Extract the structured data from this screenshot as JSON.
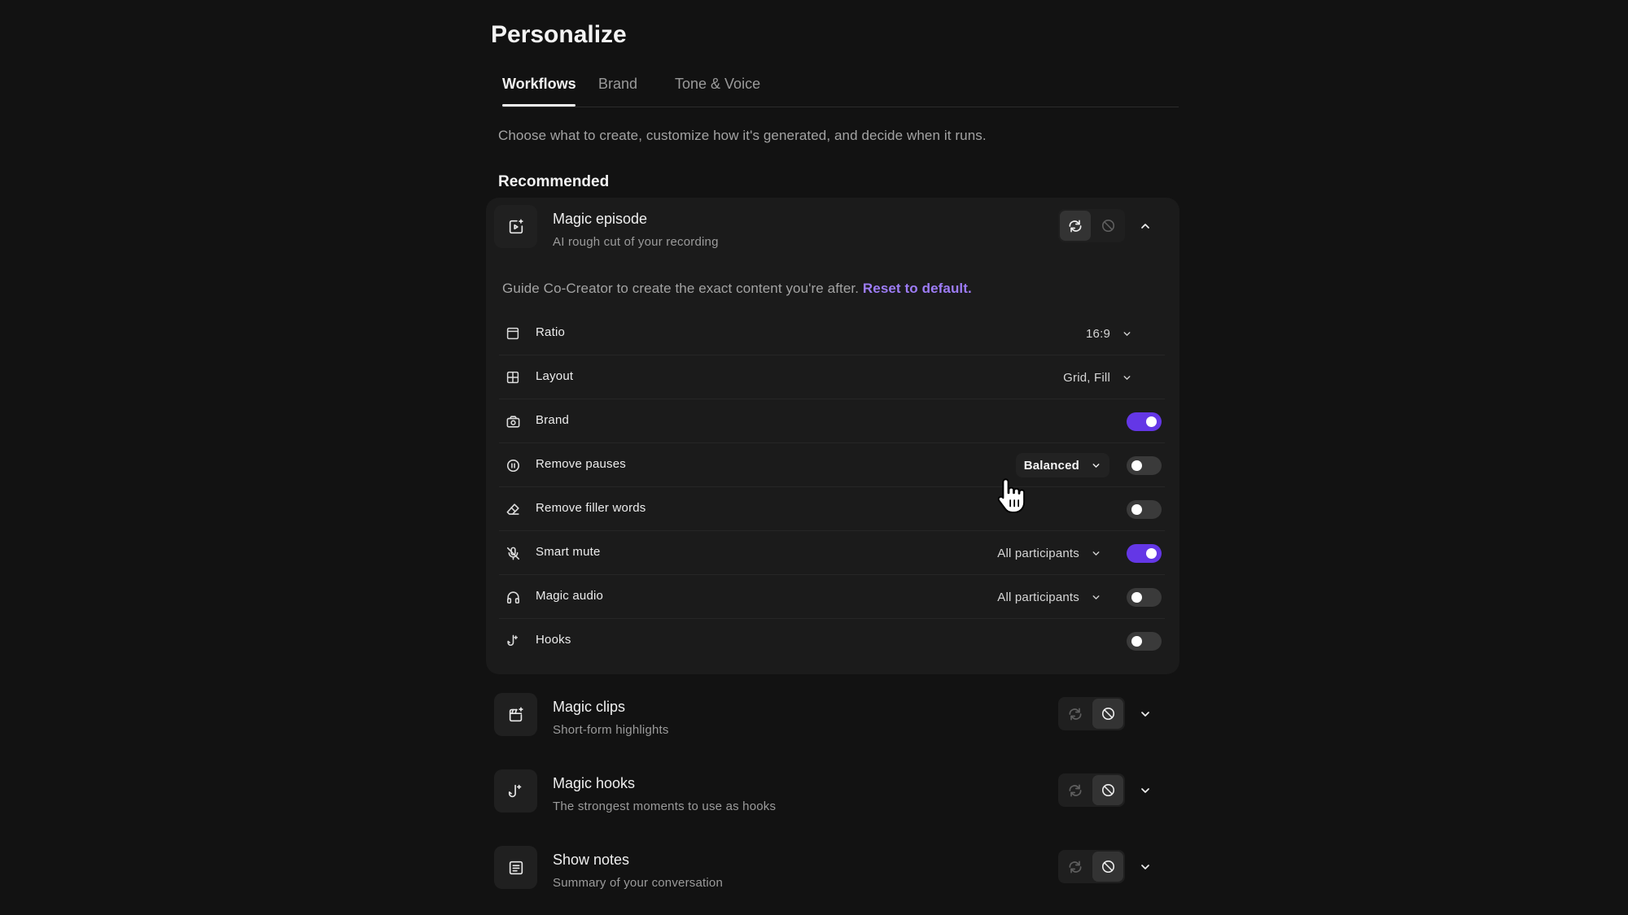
{
  "page": {
    "title": "Personalize"
  },
  "tabs": [
    {
      "label": "Workflows",
      "active": true
    },
    {
      "label": "Brand",
      "active": false
    },
    {
      "label": "Tone & Voice",
      "active": false
    }
  ],
  "description": "Choose what to create, customize how it's generated, and decide when it runs.",
  "section_title": "Recommended",
  "colors": {
    "accent": "#6437e6",
    "link": "#9d7cf5",
    "background": "#121212",
    "card": "#1b1b1b"
  },
  "workflows": [
    {
      "title": "Magic episode",
      "subtitle": "AI rough cut of your recording",
      "icon": "video-sparkle-icon",
      "mode": "auto",
      "expanded": true,
      "guide_text": "Guide Co-Creator to create the exact content you're after.",
      "reset_label": "Reset to default.",
      "settings": [
        {
          "label": "Ratio",
          "icon": "ratio-icon",
          "value": "16:9"
        },
        {
          "label": "Layout",
          "icon": "layout-grid-icon",
          "value": "Grid, Fill"
        },
        {
          "label": "Brand",
          "icon": "brand-icon",
          "enabled": true
        },
        {
          "label": "Remove pauses",
          "icon": "pause-icon",
          "value": "Balanced",
          "enabled": false
        },
        {
          "label": "Remove filler words",
          "icon": "eraser-icon",
          "enabled": false
        },
        {
          "label": "Smart mute",
          "icon": "mic-off-icon",
          "value": "All participants",
          "enabled": true
        },
        {
          "label": "Magic audio",
          "icon": "headphones-icon",
          "value": "All participants",
          "enabled": false
        },
        {
          "label": "Hooks",
          "icon": "hook-icon",
          "enabled": false
        }
      ]
    },
    {
      "title": "Magic clips",
      "subtitle": "Short-form highlights",
      "icon": "clips-sparkle-icon",
      "mode": "off",
      "expanded": false
    },
    {
      "title": "Magic hooks",
      "subtitle": "The strongest moments to use as hooks",
      "icon": "hook-sparkle-icon",
      "mode": "off",
      "expanded": false
    },
    {
      "title": "Show notes",
      "subtitle": "Summary of your conversation",
      "icon": "notes-icon",
      "mode": "off",
      "expanded": false
    }
  ]
}
